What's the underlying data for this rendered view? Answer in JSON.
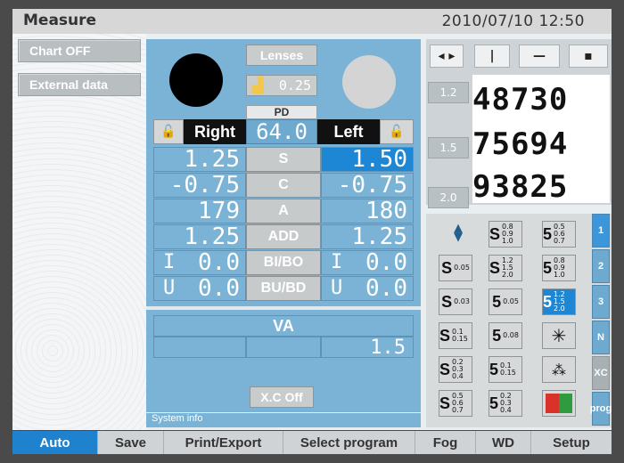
{
  "header": {
    "title": "Measure",
    "datetime": "2010/07/10   12:50"
  },
  "sidebar": {
    "items": [
      {
        "label": "Chart OFF"
      },
      {
        "label": "External data"
      }
    ]
  },
  "lenses": {
    "label": "Lenses",
    "step_value": "0.25",
    "pd_label": "PD",
    "pd_value": "64.0"
  },
  "eyes": {
    "right": "Right",
    "left": "Left"
  },
  "rows": [
    {
      "label": "S",
      "right": "1.25",
      "left": "1.50"
    },
    {
      "label": "C",
      "right": "-0.75",
      "left": "-0.75"
    },
    {
      "label": "A",
      "right": "179",
      "left": "180"
    },
    {
      "label": "ADD",
      "right": "1.25",
      "left": "1.25"
    },
    {
      "label": "BI/BO",
      "right_unit": "I",
      "right": "0.0",
      "left_unit": "I",
      "left": "0.0"
    },
    {
      "label": "BU/BD",
      "right_unit": "U",
      "right": "0.0",
      "left_unit": "U",
      "left": "0.0"
    }
  ],
  "va": {
    "label": "VA",
    "value": "1.5"
  },
  "xc_button": "X.C Off",
  "system_info": "System info",
  "chart": {
    "lines": [
      "48730",
      "75694",
      "93825"
    ],
    "sizes": [
      "1.2",
      "1.5",
      "2.0"
    ],
    "arrows": [
      "◂ ▸",
      "|",
      "—",
      "▪"
    ]
  },
  "options": [
    {
      "big": "",
      "sub": ""
    },
    {
      "big": "S",
      "sub": "0.8 0.9 1.0"
    },
    {
      "big": "5",
      "sub": "0.5 0.6 0.7"
    },
    {
      "big": "S",
      "sub": "0.05"
    },
    {
      "big": "S",
      "sub": "1.2 1.5 2.0"
    },
    {
      "big": "5",
      "sub": "0.8 0.9 1.0"
    },
    {
      "big": "S",
      "sub": "0.03"
    },
    {
      "big": "5",
      "sub": "0.05"
    },
    {
      "big": "5",
      "sub": "1.2 1.5 2.0"
    },
    {
      "big": "S",
      "sub": "0.1 0.15"
    },
    {
      "big": "5",
      "sub": "0.08"
    },
    {
      "big": "",
      "sub": ""
    },
    {
      "big": "S",
      "sub": "0.2 0.3 0.4"
    },
    {
      "big": "5",
      "sub": "0.1 0.15"
    },
    {
      "big": "",
      "sub": ""
    },
    {
      "big": "S",
      "sub": "0.5 0.6 0.7"
    },
    {
      "big": "5",
      "sub": "0.2 0.3 0.4"
    },
    {
      "big": "",
      "sub": ""
    }
  ],
  "tabs": [
    "1",
    "2",
    "3",
    "N",
    "XC",
    "prog"
  ],
  "bottom": [
    "Auto",
    "Save",
    "Print/Export",
    "Select program",
    "Fog",
    "WD",
    "Setup"
  ],
  "colors": {
    "accent": "#1f82cf",
    "panel": "#7bb3d6",
    "selected": "#1e87d5"
  }
}
